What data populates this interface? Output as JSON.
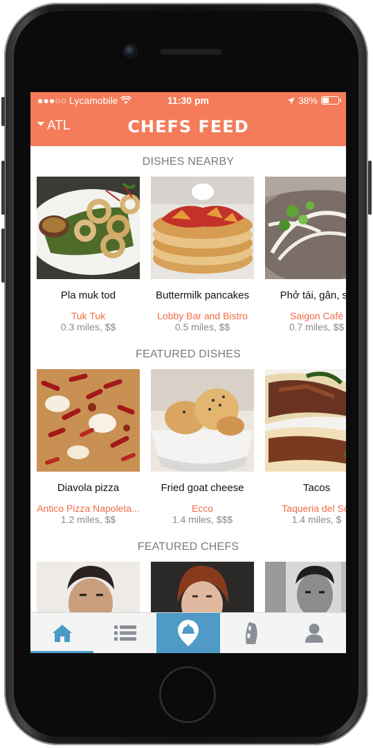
{
  "status_bar": {
    "carrier": "●●●○○ Lycamobile",
    "time": "11:30 pm",
    "battery": "38%",
    "battery_level": 0.38
  },
  "nav": {
    "city": "ATL",
    "title": "CHEFS FEED"
  },
  "sections": {
    "nearby": {
      "title": "DISHES NEARBY",
      "items": [
        {
          "name": "Pla muk tod",
          "place": "Tuk Tuk",
          "meta": "0.3 miles, $$"
        },
        {
          "name": "Buttermilk pancakes",
          "place": "Lobby Bar and Bistro",
          "meta": "0.5 miles, $$"
        },
        {
          "name": "Phở tái, gân, sa",
          "place": "Saigon Café",
          "meta": "0.7 miles, $$"
        }
      ]
    },
    "featured_dishes": {
      "title": "FEATURED DISHES",
      "items": [
        {
          "name": "Diavola pizza",
          "place": "Antico Pizza Napoleta...",
          "meta": "1.2 miles, $$"
        },
        {
          "name": "Fried goat cheese",
          "place": "Ecco",
          "meta": "1.4 miles, $$$"
        },
        {
          "name": "Tacos",
          "place": "Taqueria del Sol",
          "meta": "1.4 miles, $"
        }
      ]
    },
    "featured_chefs": {
      "title": "FEATURED CHEFS"
    }
  },
  "tabs": [
    {
      "icon": "home-icon"
    },
    {
      "icon": "list-icon"
    },
    {
      "icon": "dish-location-icon"
    },
    {
      "icon": "chef-knife-icon"
    },
    {
      "icon": "profile-icon"
    }
  ],
  "colors": {
    "brand": "#f47c5a",
    "link": "#f06b45",
    "tab_accent": "#4f9ac6"
  }
}
